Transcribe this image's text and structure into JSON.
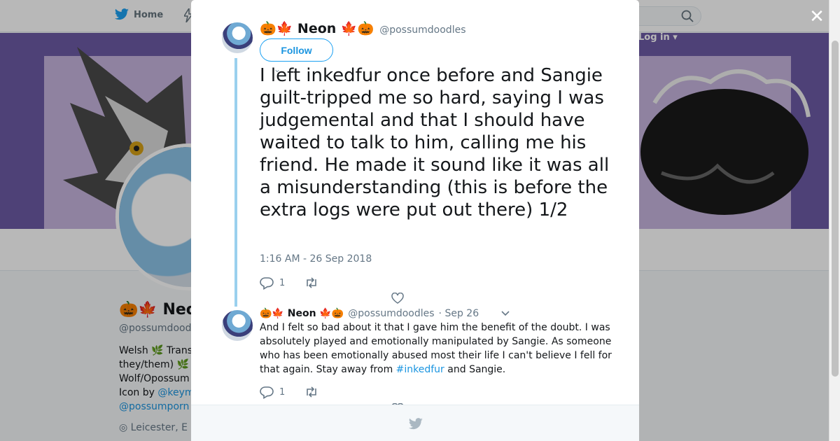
{
  "nav": {
    "home_label": "Home",
    "login_label": "Log in"
  },
  "background_profile": {
    "name": "🎃🍁 Neo",
    "handle": "@possumdood",
    "bio_lines": [
      "Welsh 🌿 Trans",
      "they/them) 🌿",
      "Wolf/Opossum",
      "Icon by "
    ],
    "bio_link_1": "@keym",
    "bio_link_2": "@possumporn",
    "location": "Leicester, E"
  },
  "tweet": {
    "display_name": "🎃🍁 Neon 🍁🎃",
    "handle": "@possumdoodles",
    "follow_label": "Follow",
    "text": "I left inkedfur once before and Sangie guilt-tripped me so hard, saying I was judgemental and that I should have waited to talk to him, calling me his friend. He made it sound like it was all a misunderstanding (this is before the extra logs were put out there) 1/2",
    "timestamp": "1:16 AM - 26 Sep 2018",
    "reply_count": "1"
  },
  "reply": {
    "display_name": "🎃🍁 Neon 🍁🎃",
    "handle": "@possumdoodles",
    "date": "· Sep 26",
    "text_before": "And I felt so bad about it that I gave him the benefit of the doubt. I was absolutely played and emotionally manipulated by Sangie. As someone who has been emotionally abused most their life I can't believe I fell for that again. Stay away from ",
    "hashtag": "#inkedfur",
    "text_after": " and Sangie.",
    "reply_count": "1"
  },
  "colors": {
    "accent": "#1b95e0",
    "thread_line": "#9ad0ee",
    "banner": "#6d5aa6"
  },
  "icons": [
    "twitter-bird-icon",
    "lightning-icon",
    "search-icon",
    "close-icon",
    "reply-icon",
    "retweet-icon",
    "heart-icon",
    "chevron-down-icon"
  ]
}
